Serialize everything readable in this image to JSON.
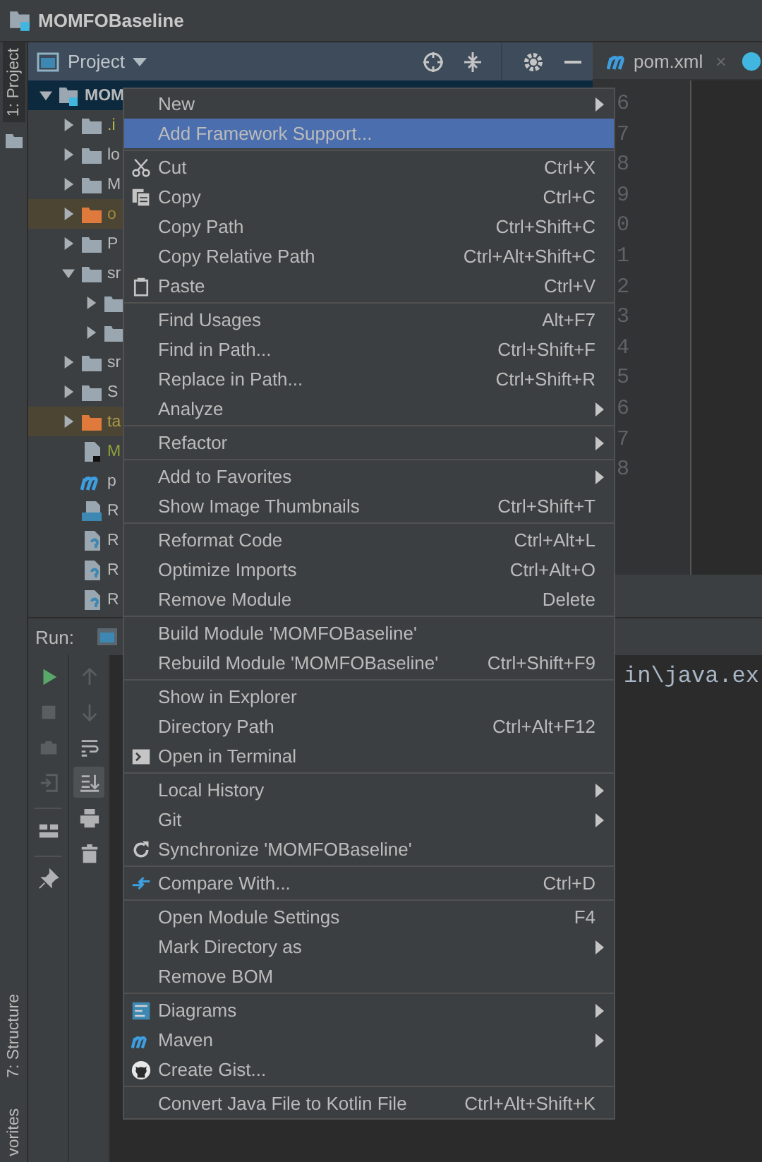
{
  "window": {
    "title": "MOMFOBaseline"
  },
  "side_tabs": [
    {
      "label": "1: Project",
      "selected": true
    },
    {
      "label": "7: Structure",
      "selected": false
    },
    {
      "label": "vorites",
      "selected": false
    }
  ],
  "project_panel": {
    "title": "Project"
  },
  "tree": {
    "items": [
      {
        "label": "MOM",
        "kind": "module",
        "expanded": true,
        "selected": true,
        "children": [
          {
            "label": ".i",
            "kind": "folder",
            "expanded": false,
            "selected": false,
            "excluded": false,
            "color": "#b9b546"
          },
          {
            "label": "lo",
            "kind": "folder",
            "expanded": false,
            "selected": false,
            "excluded": false
          },
          {
            "label": "M",
            "kind": "folder",
            "expanded": false,
            "selected": false,
            "excluded": false
          },
          {
            "label": "o",
            "kind": "folder",
            "expanded": false,
            "selected": false,
            "excluded": true,
            "color": "#a08a3c"
          },
          {
            "label": "P",
            "kind": "folder",
            "expanded": false,
            "selected": false,
            "excluded": false
          },
          {
            "label": "sr",
            "kind": "folder",
            "expanded": true,
            "selected": false,
            "excluded": false,
            "children": [
              {
                "kind": "folder",
                "expanded": false,
                "selected": false,
                "excluded": false
              },
              {
                "kind": "folder",
                "expanded": false,
                "selected": false,
                "excluded": false
              }
            ]
          },
          {
            "label": "sr",
            "kind": "folder",
            "expanded": false,
            "selected": false,
            "excluded": false
          },
          {
            "label": "S",
            "kind": "folder",
            "expanded": false,
            "selected": false,
            "excluded": false
          },
          {
            "label": "ta",
            "kind": "folder",
            "expanded": false,
            "selected": false,
            "excluded": true,
            "color": "#a89a48"
          },
          {
            "label": "M",
            "kind": "file",
            "selected": false,
            "color": "#8fa33a"
          },
          {
            "label": "p",
            "kind": "maven",
            "selected": false
          },
          {
            "label": "R",
            "kind": "markdown",
            "selected": false
          },
          {
            "label": "R",
            "kind": "unknown",
            "selected": false
          },
          {
            "label": "R",
            "kind": "unknown",
            "selected": false
          },
          {
            "label": "R",
            "kind": "unknown",
            "selected": false
          }
        ]
      }
    ]
  },
  "editor": {
    "tabs": [
      {
        "label": "pom.xml",
        "close": "×"
      }
    ],
    "line_numbers": [
      "6",
      "7",
      "8",
      "9",
      "0",
      "1",
      "2",
      "3",
      "4",
      "5",
      "6",
      "7",
      "8"
    ]
  },
  "run_panel": {
    "title": "Run:",
    "console": "in\\java.ex",
    "tools": [
      [
        {
          "disabled": false
        },
        {
          "disabled": true
        },
        {
          "disabled": true
        },
        {
          "disabled": true
        },
        {
          "disabled": false
        },
        {
          "disabled": false
        }
      ],
      [
        {
          "disabled": true,
          "selected": false
        },
        {
          "disabled": true,
          "selected": false
        },
        {
          "disabled": false,
          "selected": false
        },
        {
          "disabled": false,
          "selected": true
        },
        {
          "disabled": false,
          "selected": false
        },
        {
          "disabled": false,
          "selected": false
        }
      ]
    ]
  },
  "context_menu": {
    "groups": [
      [
        {
          "label": "New",
          "submenu": true,
          "selected": false
        },
        {
          "label": "Add Framework Support...",
          "submenu": false,
          "selected": true
        }
      ],
      [
        {
          "label": "Cut",
          "shortcut": "Ctrl+X",
          "submenu": false,
          "selected": false
        },
        {
          "label": "Copy",
          "shortcut": "Ctrl+C",
          "submenu": false,
          "selected": false
        },
        {
          "label": "Copy Path",
          "shortcut": "Ctrl+Shift+C",
          "submenu": false,
          "selected": false
        },
        {
          "label": "Copy Relative Path",
          "shortcut": "Ctrl+Alt+Shift+C",
          "submenu": false,
          "selected": false
        },
        {
          "label": "Paste",
          "shortcut": "Ctrl+V",
          "submenu": false,
          "selected": false
        }
      ],
      [
        {
          "label": "Find Usages",
          "shortcut": "Alt+F7",
          "submenu": false,
          "selected": false
        },
        {
          "label": "Find in Path...",
          "shortcut": "Ctrl+Shift+F",
          "submenu": false,
          "selected": false
        },
        {
          "label": "Replace in Path...",
          "shortcut": "Ctrl+Shift+R",
          "submenu": false,
          "selected": false
        },
        {
          "label": "Analyze",
          "submenu": true,
          "selected": false
        }
      ],
      [
        {
          "label": "Refactor",
          "submenu": true,
          "selected": false
        }
      ],
      [
        {
          "label": "Add to Favorites",
          "submenu": true,
          "selected": false
        },
        {
          "label": "Show Image Thumbnails",
          "shortcut": "Ctrl+Shift+T",
          "submenu": false,
          "selected": false
        }
      ],
      [
        {
          "label": "Reformat Code",
          "shortcut": "Ctrl+Alt+L",
          "submenu": false,
          "selected": false
        },
        {
          "label": "Optimize Imports",
          "shortcut": "Ctrl+Alt+O",
          "submenu": false,
          "selected": false
        },
        {
          "label": "Remove Module",
          "shortcut": "Delete",
          "submenu": false,
          "selected": false
        }
      ],
      [
        {
          "label": "Build Module 'MOMFOBaseline'",
          "submenu": false,
          "selected": false
        },
        {
          "label": "Rebuild Module 'MOMFOBaseline'",
          "shortcut": "Ctrl+Shift+F9",
          "submenu": false,
          "selected": false
        }
      ],
      [
        {
          "label": "Show in Explorer",
          "submenu": false,
          "selected": false
        },
        {
          "label": "Directory Path",
          "shortcut": "Ctrl+Alt+F12",
          "submenu": false,
          "selected": false
        },
        {
          "label": "Open in Terminal",
          "submenu": false,
          "selected": false
        }
      ],
      [
        {
          "label": "Local History",
          "submenu": true,
          "selected": false
        },
        {
          "label": "Git",
          "submenu": true,
          "selected": false
        },
        {
          "label": "Synchronize 'MOMFOBaseline'",
          "submenu": false,
          "selected": false
        }
      ],
      [
        {
          "label": "Compare With...",
          "shortcut": "Ctrl+D",
          "submenu": false,
          "selected": false
        }
      ],
      [
        {
          "label": "Open Module Settings",
          "shortcut": "F4",
          "submenu": false,
          "selected": false
        },
        {
          "label": "Mark Directory as",
          "submenu": true,
          "selected": false
        },
        {
          "label": "Remove BOM",
          "submenu": false,
          "selected": false
        }
      ],
      [
        {
          "label": "Diagrams",
          "submenu": true,
          "selected": false
        },
        {
          "label": "Maven",
          "submenu": true,
          "selected": false
        },
        {
          "label": "Create Gist...",
          "submenu": false,
          "selected": false
        }
      ],
      [
        {
          "label": "Convert Java File to Kotlin File",
          "shortcut": "Ctrl+Alt+Shift+K",
          "submenu": false,
          "selected": false
        }
      ]
    ]
  }
}
